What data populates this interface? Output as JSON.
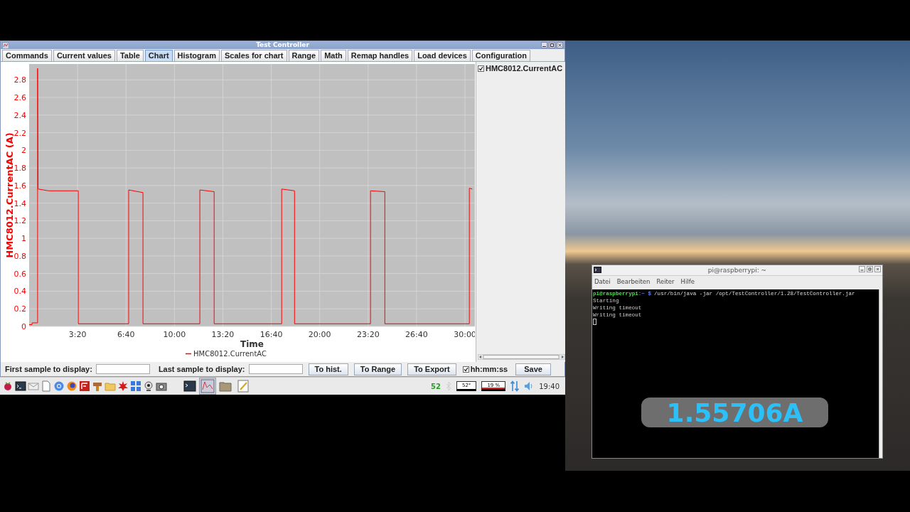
{
  "app_window": {
    "title": "Test Controller",
    "tabs": [
      {
        "label": "Commands",
        "selected": false
      },
      {
        "label": "Current values",
        "selected": false
      },
      {
        "label": "Table",
        "selected": false
      },
      {
        "label": "Chart",
        "selected": true
      },
      {
        "label": "Histogram",
        "selected": false
      },
      {
        "label": "Scales for chart",
        "selected": false
      },
      {
        "label": "Range",
        "selected": false
      },
      {
        "label": "Math",
        "selected": false
      },
      {
        "label": "Remap handles",
        "selected": false
      },
      {
        "label": "Load devices",
        "selected": false
      },
      {
        "label": "Configuration",
        "selected": false
      }
    ],
    "chart": {
      "chart_data": {
        "type": "line",
        "grid": true,
        "xlabel": "Time",
        "ylabel": "HMC8012.CurrentAC (A)",
        "xlim": [
          0,
          1841
        ],
        "ylim": [
          0,
          2.98
        ],
        "x": [
          0,
          12,
          12,
          35,
          35,
          37,
          80,
          203,
          203,
          411,
          411,
          470,
          470,
          705,
          705,
          764,
          764,
          1043,
          1043,
          1096,
          1096,
          1410,
          1410,
          1469,
          1469,
          1818,
          1818,
          1830
        ],
        "series": [
          {
            "name": "HMC8012.CurrentAC",
            "color": "#ff0000",
            "values": [
              0.02,
              0.02,
              0.04,
              0.04,
              2.93,
              1.56,
              1.54,
              1.54,
              0.03,
              0.03,
              1.55,
              1.52,
              0.03,
              0.03,
              1.55,
              1.53,
              0.03,
              0.03,
              1.56,
              1.54,
              0.03,
              0.03,
              1.54,
              1.53,
              0.03,
              0.03,
              1.57,
              1.56
            ]
          }
        ],
        "xticks": [
          {
            "value": 200,
            "label": "3:20"
          },
          {
            "value": 400,
            "label": "6:40"
          },
          {
            "value": 600,
            "label": "10:00"
          },
          {
            "value": 800,
            "label": "13:20"
          },
          {
            "value": 1000,
            "label": "16:40"
          },
          {
            "value": 1200,
            "label": "20:00"
          },
          {
            "value": 1400,
            "label": "23:20"
          },
          {
            "value": 1600,
            "label": "26:40"
          },
          {
            "value": 1800,
            "label": "30:00"
          }
        ],
        "yticks": [
          0,
          0.2,
          0.4,
          0.6,
          0.8,
          1,
          1.2,
          1.4,
          1.6,
          1.8,
          2,
          2.2,
          2.4,
          2.6,
          2.8
        ]
      }
    },
    "series_list": [
      {
        "label": "HMC8012.CurrentAC",
        "checked": true
      }
    ],
    "first_sample_label": "First sample to display:",
    "last_sample_label": "Last sample to display:",
    "buttons": [
      "To hist.",
      "To Range",
      "To Export"
    ],
    "time_format": {
      "label": "hh:mm:ss",
      "checked": true
    },
    "save_button": "Save"
  },
  "taskbar": {
    "status_number": "52",
    "temperature": "52°",
    "cpu_usage": "19 %",
    "clock": "19:40"
  },
  "terminal": {
    "title": "pi@raspberrypi: ~",
    "menu": [
      "Datei",
      "Bearbeiten",
      "Reiter",
      "Hilfe"
    ],
    "prompt": {
      "user": "pi@raspberrypi",
      "path": ":~ $",
      "command": "/usr/bin/java -jar /opt/TestController/1.28/TestController.jar"
    },
    "output": [
      "Starting",
      "Writing timeout",
      "Writing timeout"
    ]
  },
  "overlay": {
    "reading": "1.55706A"
  }
}
